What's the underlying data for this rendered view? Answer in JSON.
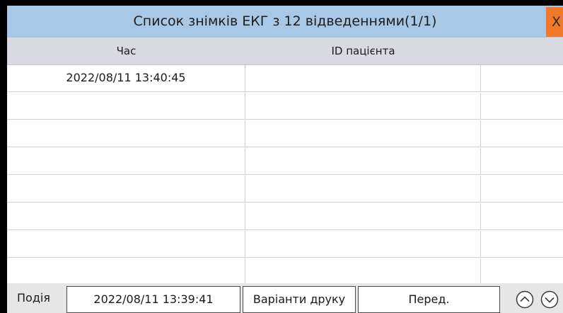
{
  "dialog": {
    "title": "Список знімків ЕКГ з 12 відведеннями(1/1)",
    "close_label": "X"
  },
  "table": {
    "headers": [
      "Час",
      "ID пацієнта",
      ""
    ],
    "rows": [
      [
        "2022/08/11 13:40:45",
        "",
        ""
      ],
      [
        "",
        "",
        ""
      ],
      [
        "",
        "",
        ""
      ],
      [
        "",
        "",
        ""
      ],
      [
        "",
        "",
        ""
      ],
      [
        "",
        "",
        ""
      ],
      [
        "",
        "",
        ""
      ],
      [
        "",
        "",
        ""
      ]
    ]
  },
  "footer": {
    "event_label": "Подія",
    "event_time": "2022/08/11 13:39:41",
    "print_options_label": "Варіанти друку",
    "review_label": "Перед.",
    "page_up_icon": "chevron-up-circle-icon",
    "page_down_icon": "chevron-down-circle-icon"
  },
  "colors": {
    "title_bar": "#a8c8e8",
    "close_button": "#f07a2a",
    "header_row": "#d9d9e1",
    "background": "#e6e6e6"
  }
}
